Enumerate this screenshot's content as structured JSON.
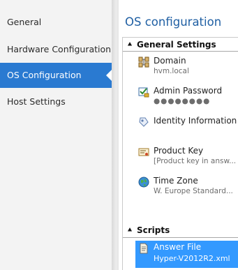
{
  "nav": {
    "items": [
      {
        "label": "General"
      },
      {
        "label": "Hardware Configuration"
      },
      {
        "label": "OS Configuration"
      },
      {
        "label": "Host Settings"
      }
    ],
    "selected": "OS Configuration"
  },
  "main": {
    "title": "OS configuration",
    "sections": [
      {
        "label": "General Settings",
        "items": [
          {
            "title": "Domain",
            "value": "hvm.local",
            "icon": "domain-icon"
          },
          {
            "title": "Admin Password",
            "value": "●●●●●●●●",
            "icon": "password-icon"
          },
          {
            "title": "Identity Information",
            "value": "",
            "icon": "identity-icon"
          },
          {
            "title": "Product Key",
            "value": "[Product key in answ...",
            "icon": "product-key-icon"
          },
          {
            "title": "Time Zone",
            "value": "W. Europe Standard...",
            "icon": "globe-icon"
          }
        ]
      },
      {
        "label": "Scripts",
        "items": [
          {
            "title": "Answer File",
            "value": "Hyper-V2012R2.xml",
            "icon": "answer-file-icon",
            "selected": true
          }
        ]
      }
    ]
  },
  "colors": {
    "nav_selected": "#2a7ad1",
    "item_selected": "#3399ff",
    "title": "#1f5fa3"
  }
}
